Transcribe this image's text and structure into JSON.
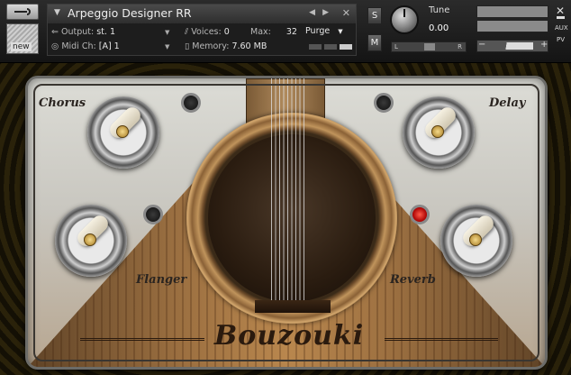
{
  "header": {
    "instrument_name": "Arpeggio Designer RR",
    "output_label": "Output:",
    "output_value": "st. 1",
    "midi_label": "Midi Ch:",
    "midi_value": "[A] 1",
    "voices_label": "Voices:",
    "voices_value": "0",
    "max_label": "Max:",
    "max_value": "32",
    "memory_label": "Memory:",
    "memory_value": "7.60 MB",
    "purge_label": "Purge",
    "solo_label": "S",
    "mute_label": "M",
    "tune_label": "Tune",
    "tune_value": "0.00",
    "pan_left": "L",
    "pan_right": "R",
    "aux_label": "AUX",
    "pv_label": "PV",
    "new_badge": "new"
  },
  "instrument": {
    "brand": "Bouzouki",
    "chorus_label": "Chorus",
    "delay_label": "Delay",
    "flanger_label": "Flanger",
    "reverb_label": "Reverb"
  },
  "colors": {
    "led_active": "#e01e14",
    "plate": "#cfcdc6",
    "wood": "#9b6d3c"
  }
}
